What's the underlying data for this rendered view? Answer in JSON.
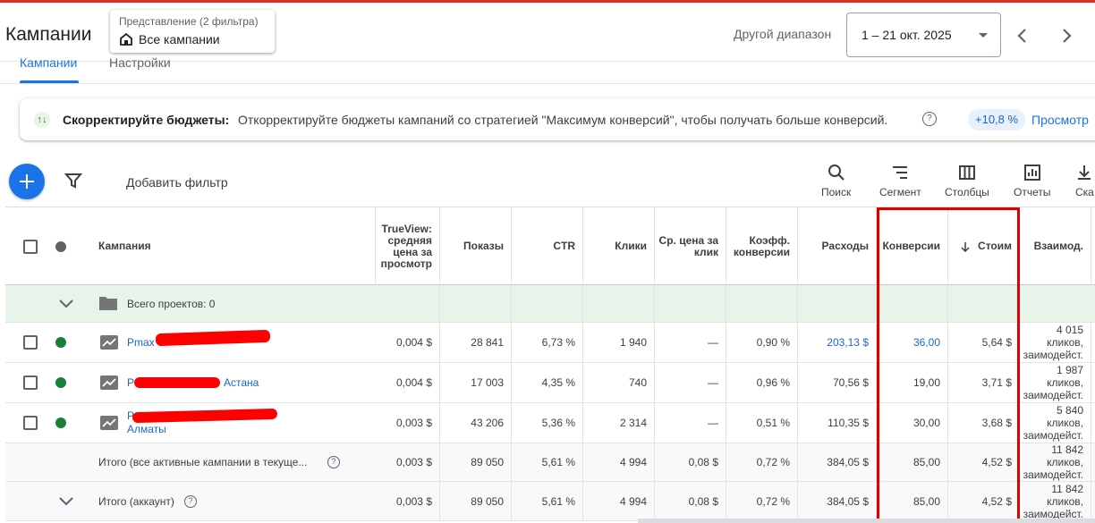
{
  "header": {
    "title": "Кампании",
    "view_chip_sub": "Представление (2 фильтра)",
    "view_chip_main": "Все кампании",
    "range_label": "Другой диапазон",
    "date_range": "1 – 21 окт. 2025"
  },
  "tabs": [
    {
      "label": "Кампании",
      "active": true
    },
    {
      "label": "Настройки",
      "active": false
    }
  ],
  "recommendation": {
    "title": "Скорректируйте бюджеты:",
    "text": "Откорректируйте бюджеты кампаний со стратегией \"Максимум конверсий\", чтобы получать больше конверсий.",
    "badge": "+10,8 %",
    "link": "Просмотр"
  },
  "toolbar": {
    "add_filter": "Добавить фильтр",
    "tools": [
      "Поиск",
      "Сегмент",
      "Столбцы",
      "Отчеты",
      "Ска"
    ]
  },
  "table": {
    "headers": {
      "campaign": "Кампания",
      "trueview": "TrueView: средняя цена за просмотр",
      "impressions": "Показы",
      "ctr": "CTR",
      "clicks": "Клики",
      "avg_cpc": "Ср. цена за клик",
      "conv_rate": "Коэфф. конверсии",
      "cost": "Расходы",
      "conversions": "Конверсии",
      "cost_per_conv": "Стоим",
      "interactions": "Взаимод."
    },
    "group_row": {
      "label": "Всего проектов: 0"
    },
    "rows": [
      {
        "name": "Pmax",
        "name_suffix": "",
        "status_color": "#188038",
        "trueview": "0,004 $",
        "impressions": "28 841",
        "ctr": "6,73 %",
        "clicks": "1 940",
        "avg_cpc": "—",
        "conv_rate": "0,90 %",
        "cost": "203,13 $",
        "conversions": "36,00",
        "cost_per_conv": "5,64 $",
        "interactions": "4 015 кликов, заимодейст."
      },
      {
        "name": "Р",
        "name_suffix": "Астана",
        "status_color": "#188038",
        "trueview": "0,004 $",
        "impressions": "17 003",
        "ctr": "4,35 %",
        "clicks": "740",
        "avg_cpc": "—",
        "conv_rate": "0,96 %",
        "cost": "70,56 $",
        "conversions": "19,00",
        "cost_per_conv": "3,71 $",
        "interactions": "1 987 кликов, заимодейст."
      },
      {
        "name": "Р",
        "name_suffix": "Алматы",
        "status_color": "#188038",
        "trueview": "0,003 $",
        "impressions": "43 206",
        "ctr": "5,36 %",
        "clicks": "2 314",
        "avg_cpc": "—",
        "conv_rate": "0,51 %",
        "cost": "110,35 $",
        "conversions": "30,00",
        "cost_per_conv": "3,68 $",
        "interactions": "5 840 кликов, заимодейст."
      }
    ],
    "totals": [
      {
        "label": "Итого (все активные кампании в текуще...",
        "trueview": "0,003 $",
        "impressions": "89 050",
        "ctr": "5,61 %",
        "clicks": "4 994",
        "avg_cpc": "0,08 $",
        "conv_rate": "0,72 %",
        "cost": "384,05 $",
        "conversions": "85,00",
        "cost_per_conv": "4,52 $",
        "interactions": "11 842 кликов, заимодейст."
      },
      {
        "label": "Итого (аккаунт)",
        "trueview": "0,003 $",
        "impressions": "89 050",
        "ctr": "5,61 %",
        "clicks": "4 994",
        "avg_cpc": "0,08 $",
        "conv_rate": "0,72 %",
        "cost": "384,05 $",
        "conversions": "85,00",
        "cost_per_conv": "4,52 $",
        "interactions": "11 842 кликов, заимодейст."
      }
    ]
  },
  "colors": {
    "accent": "#1a73e8",
    "status_active": "#188038",
    "highlight": "#e00000",
    "group_row_bg": "#e6f4ea"
  }
}
